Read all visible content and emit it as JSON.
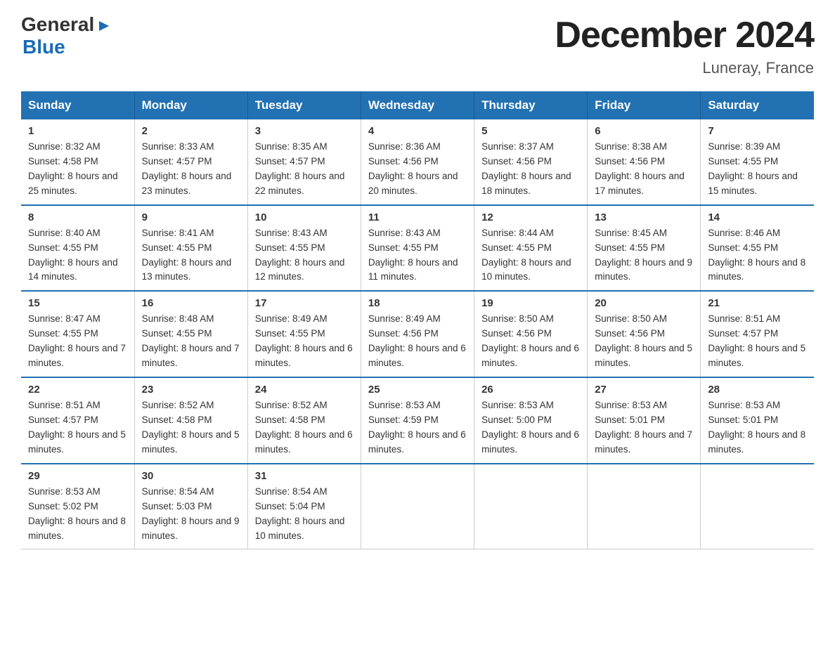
{
  "header": {
    "logo_line1": "General",
    "logo_line2": "Blue",
    "month_title": "December 2024",
    "location": "Luneray, France"
  },
  "days_of_week": [
    "Sunday",
    "Monday",
    "Tuesday",
    "Wednesday",
    "Thursday",
    "Friday",
    "Saturday"
  ],
  "weeks": [
    [
      {
        "day": "1",
        "sunrise": "8:32 AM",
        "sunset": "4:58 PM",
        "daylight": "8 hours and 25 minutes."
      },
      {
        "day": "2",
        "sunrise": "8:33 AM",
        "sunset": "4:57 PM",
        "daylight": "8 hours and 23 minutes."
      },
      {
        "day": "3",
        "sunrise": "8:35 AM",
        "sunset": "4:57 PM",
        "daylight": "8 hours and 22 minutes."
      },
      {
        "day": "4",
        "sunrise": "8:36 AM",
        "sunset": "4:56 PM",
        "daylight": "8 hours and 20 minutes."
      },
      {
        "day": "5",
        "sunrise": "8:37 AM",
        "sunset": "4:56 PM",
        "daylight": "8 hours and 18 minutes."
      },
      {
        "day": "6",
        "sunrise": "8:38 AM",
        "sunset": "4:56 PM",
        "daylight": "8 hours and 17 minutes."
      },
      {
        "day": "7",
        "sunrise": "8:39 AM",
        "sunset": "4:55 PM",
        "daylight": "8 hours and 15 minutes."
      }
    ],
    [
      {
        "day": "8",
        "sunrise": "8:40 AM",
        "sunset": "4:55 PM",
        "daylight": "8 hours and 14 minutes."
      },
      {
        "day": "9",
        "sunrise": "8:41 AM",
        "sunset": "4:55 PM",
        "daylight": "8 hours and 13 minutes."
      },
      {
        "day": "10",
        "sunrise": "8:43 AM",
        "sunset": "4:55 PM",
        "daylight": "8 hours and 12 minutes."
      },
      {
        "day": "11",
        "sunrise": "8:43 AM",
        "sunset": "4:55 PM",
        "daylight": "8 hours and 11 minutes."
      },
      {
        "day": "12",
        "sunrise": "8:44 AM",
        "sunset": "4:55 PM",
        "daylight": "8 hours and 10 minutes."
      },
      {
        "day": "13",
        "sunrise": "8:45 AM",
        "sunset": "4:55 PM",
        "daylight": "8 hours and 9 minutes."
      },
      {
        "day": "14",
        "sunrise": "8:46 AM",
        "sunset": "4:55 PM",
        "daylight": "8 hours and 8 minutes."
      }
    ],
    [
      {
        "day": "15",
        "sunrise": "8:47 AM",
        "sunset": "4:55 PM",
        "daylight": "8 hours and 7 minutes."
      },
      {
        "day": "16",
        "sunrise": "8:48 AM",
        "sunset": "4:55 PM",
        "daylight": "8 hours and 7 minutes."
      },
      {
        "day": "17",
        "sunrise": "8:49 AM",
        "sunset": "4:55 PM",
        "daylight": "8 hours and 6 minutes."
      },
      {
        "day": "18",
        "sunrise": "8:49 AM",
        "sunset": "4:56 PM",
        "daylight": "8 hours and 6 minutes."
      },
      {
        "day": "19",
        "sunrise": "8:50 AM",
        "sunset": "4:56 PM",
        "daylight": "8 hours and 6 minutes."
      },
      {
        "day": "20",
        "sunrise": "8:50 AM",
        "sunset": "4:56 PM",
        "daylight": "8 hours and 5 minutes."
      },
      {
        "day": "21",
        "sunrise": "8:51 AM",
        "sunset": "4:57 PM",
        "daylight": "8 hours and 5 minutes."
      }
    ],
    [
      {
        "day": "22",
        "sunrise": "8:51 AM",
        "sunset": "4:57 PM",
        "daylight": "8 hours and 5 minutes."
      },
      {
        "day": "23",
        "sunrise": "8:52 AM",
        "sunset": "4:58 PM",
        "daylight": "8 hours and 5 minutes."
      },
      {
        "day": "24",
        "sunrise": "8:52 AM",
        "sunset": "4:58 PM",
        "daylight": "8 hours and 6 minutes."
      },
      {
        "day": "25",
        "sunrise": "8:53 AM",
        "sunset": "4:59 PM",
        "daylight": "8 hours and 6 minutes."
      },
      {
        "day": "26",
        "sunrise": "8:53 AM",
        "sunset": "5:00 PM",
        "daylight": "8 hours and 6 minutes."
      },
      {
        "day": "27",
        "sunrise": "8:53 AM",
        "sunset": "5:01 PM",
        "daylight": "8 hours and 7 minutes."
      },
      {
        "day": "28",
        "sunrise": "8:53 AM",
        "sunset": "5:01 PM",
        "daylight": "8 hours and 8 minutes."
      }
    ],
    [
      {
        "day": "29",
        "sunrise": "8:53 AM",
        "sunset": "5:02 PM",
        "daylight": "8 hours and 8 minutes."
      },
      {
        "day": "30",
        "sunrise": "8:54 AM",
        "sunset": "5:03 PM",
        "daylight": "8 hours and 9 minutes."
      },
      {
        "day": "31",
        "sunrise": "8:54 AM",
        "sunset": "5:04 PM",
        "daylight": "8 hours and 10 minutes."
      },
      null,
      null,
      null,
      null
    ]
  ]
}
